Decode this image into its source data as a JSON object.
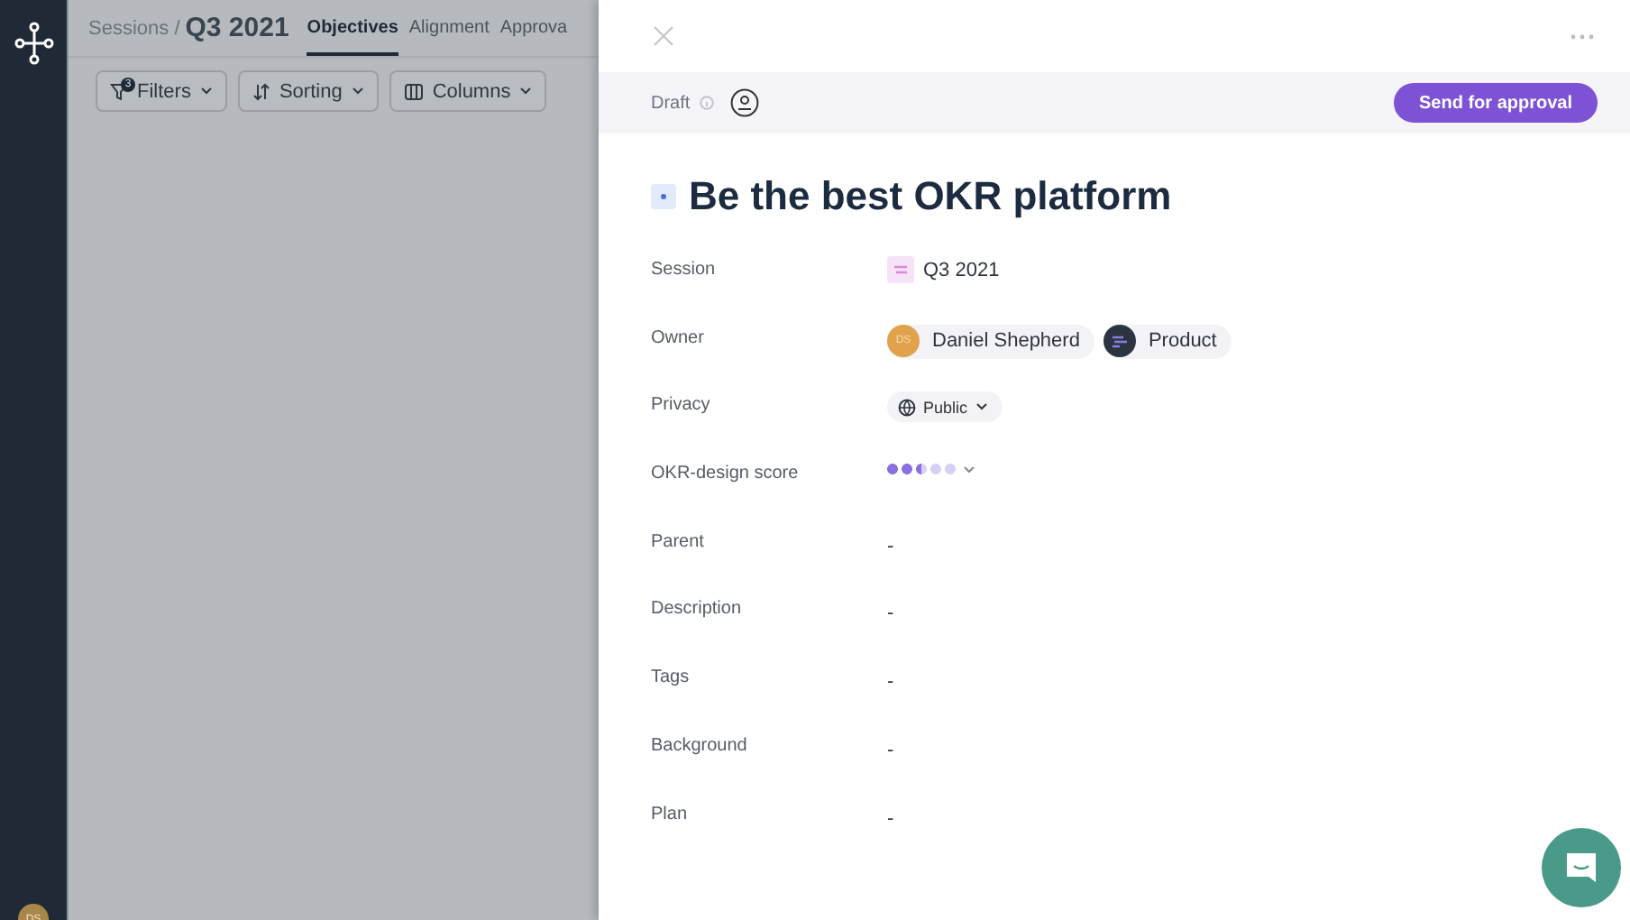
{
  "breadcrumb": {
    "parent": "Sessions /",
    "current": "Q3 2021"
  },
  "tabs": [
    {
      "label": "Objectives",
      "selected": true
    },
    {
      "label": "Alignment",
      "selected": false
    },
    {
      "label": "Approva",
      "selected": false
    }
  ],
  "toolbar": [
    {
      "label": "Filters",
      "badge": "3",
      "kind": "filter"
    },
    {
      "label": "Sorting",
      "kind": "sort"
    },
    {
      "label": "Columns",
      "kind": "columns"
    }
  ],
  "user_avatar": {
    "initials": "DS"
  },
  "panel": {
    "status": "Draft",
    "action": "Send for approval",
    "title": "Be the best OKR platform",
    "fields": [
      {
        "label": "Session",
        "kind": "session",
        "value": "Q3 2021"
      },
      {
        "label": "Owner",
        "kind": "owners",
        "owners": [
          {
            "name": "Daniel Shepherd",
            "initials": "DS",
            "color": "#e0a24a"
          },
          {
            "name": "Product",
            "color": "#2b3440"
          }
        ]
      },
      {
        "label": "Privacy",
        "kind": "dropdown",
        "value": "Public"
      },
      {
        "label": "OKR-design score",
        "kind": "score",
        "level": 0.5
      },
      {
        "label": "Parent",
        "kind": "text",
        "value": "-"
      },
      {
        "label": "Description",
        "kind": "text",
        "value": "-"
      },
      {
        "label": "Tags",
        "kind": "text",
        "value": "-"
      },
      {
        "label": "Background",
        "kind": "text",
        "value": "-"
      },
      {
        "label": "Plan",
        "kind": "text",
        "value": "-"
      }
    ]
  }
}
